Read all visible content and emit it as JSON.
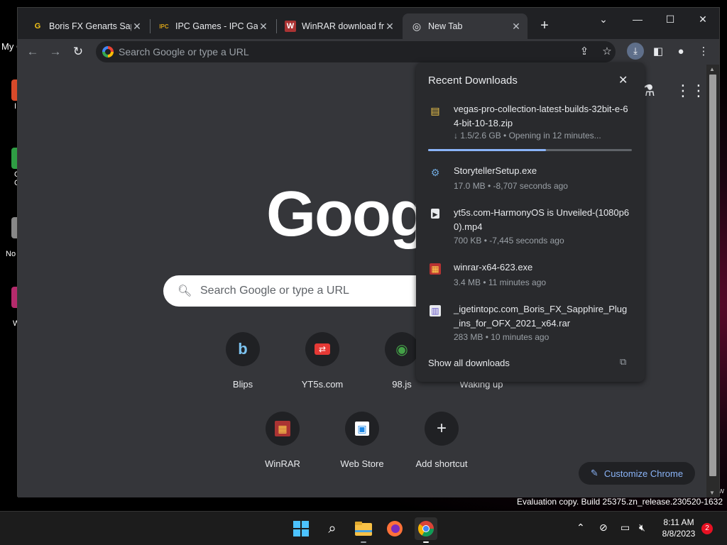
{
  "desktop": {
    "top_label": "My C",
    "icons": [
      {
        "label": "I",
        "color": "#d84a2a"
      },
      {
        "label": "G\nC",
        "color": "#2f9e44"
      },
      {
        "label": "No",
        "color": "#888888"
      },
      {
        "label": "W",
        "color": "#b52b6c"
      }
    ],
    "eval_text": "Evaluation copy. Build 25375.zn_release.230520-1632",
    "eval_w": "w"
  },
  "tabs": [
    {
      "title": "Boris FX Genarts Sapphire",
      "favicon": "G",
      "favicon_color": "#f5c518",
      "active": false
    },
    {
      "title": "IPC Games - IPC Games",
      "favicon": "IPC",
      "favicon_color": "#d4a017",
      "active": false
    },
    {
      "title": "WinRAR download free",
      "favicon": "W",
      "favicon_color": "#a33",
      "active": false
    },
    {
      "title": "New Tab",
      "favicon": "◎",
      "favicon_color": "#e8eaed",
      "active": true
    }
  ],
  "window_controls": {
    "dropdown": "⌄",
    "minimize": "—",
    "maximize": "☐",
    "close": "✕"
  },
  "toolbar": {
    "omnibox_placeholder": "Search Google or type a URL",
    "icons": [
      "share-icon",
      "star-icon",
      "download-icon",
      "sidepanel-icon",
      "profile-icon",
      "menu-icon"
    ]
  },
  "ntp": {
    "logo": "Goog",
    "search_placeholder": "Search Google or type a URL",
    "shortcuts_row1": [
      {
        "label": "Blips",
        "icon": "b",
        "color": "#7cc3f0"
      },
      {
        "label": "YT5s.com",
        "icon": "⇄",
        "color": "#e53935"
      },
      {
        "label": "98.js",
        "icon": "◉",
        "color": "#43a047"
      },
      {
        "label": "Waking up",
        "icon": "",
        "color": "#888"
      }
    ],
    "shortcuts_row2": [
      {
        "label": "WinRAR",
        "icon": "▦",
        "color": "#a33"
      },
      {
        "label": "Web Store",
        "icon": "▣",
        "color": "#1e88e5"
      },
      {
        "label": "Add shortcut",
        "icon": "+",
        "color": "#e8eaed"
      }
    ],
    "customize_label": "Customize Chrome"
  },
  "downloads": {
    "title": "Recent Downloads",
    "progress_fraction": 0.58,
    "items": [
      {
        "name": "vegas-pro-collection-latest-builds-32bit-e-64-bit-10-18.zip",
        "status": "↓ 1.5/2.6 GB • Opening in 12 minutes...",
        "icon": "▤",
        "icon_color": "#f2c94c"
      },
      {
        "name": "StorytellerSetup.exe",
        "status": "17.0 MB • -8,707 seconds ago",
        "icon": "⚙",
        "icon_color": "#6fa8dc"
      },
      {
        "name": "yt5s.com-HarmonyOS is Unveiled-(1080p60).mp4",
        "status": "700 KB • -7,445 seconds ago",
        "icon": "▶",
        "icon_color": "#e8eaed"
      },
      {
        "name": "winrar-x64-623.exe",
        "status": "3.4 MB • 11 minutes ago",
        "icon": "▦",
        "icon_color": "#b83232"
      },
      {
        "name": "_igetintopc.com_Boris_FX_Sapphire_Plug_ins_for_OFX_2021_x64.rar",
        "status": "283 MB • 10 minutes ago",
        "icon": "▥",
        "icon_color": "#6a5acd"
      }
    ],
    "show_all": "Show all downloads"
  },
  "taskbar": {
    "clock_time": "8:11 AM",
    "clock_date": "8/8/2023",
    "notification_count": "2"
  }
}
